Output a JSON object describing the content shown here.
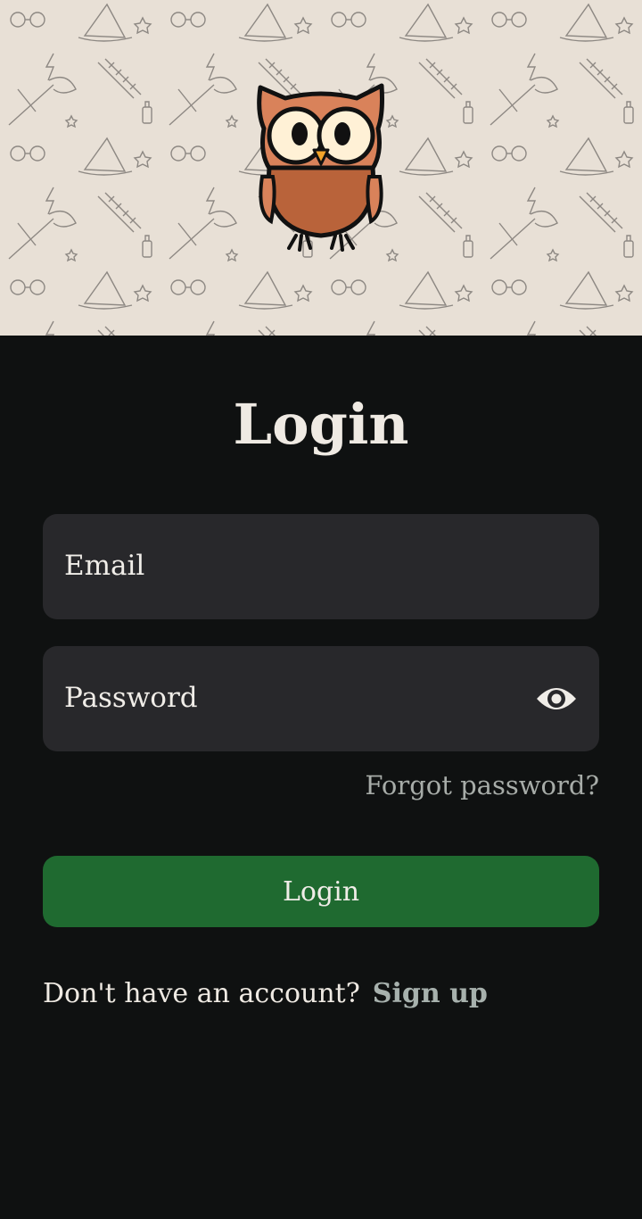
{
  "header": {
    "mascot_icon": "owl-icon",
    "pattern_icons": [
      "wizard-hat-icon",
      "glasses-icon",
      "broom-icon",
      "scarf-icon",
      "wand-icon",
      "star-icon",
      "lightning-icon"
    ]
  },
  "login": {
    "title": "Login",
    "email_placeholder": "Email",
    "password_placeholder": "Password",
    "toggle_visibility_icon": "eye-icon",
    "forgot_label": "Forgot password?",
    "submit_label": "Login",
    "no_account_text": "Don't have an account?",
    "signup_label": "Sign up"
  },
  "colors": {
    "background": "#0f1111",
    "field": "#28282b",
    "accent_button": "#1f6a30",
    "text": "#efeae3",
    "muted_text": "#a7aca8",
    "header_paper": "#e8e0d6"
  }
}
